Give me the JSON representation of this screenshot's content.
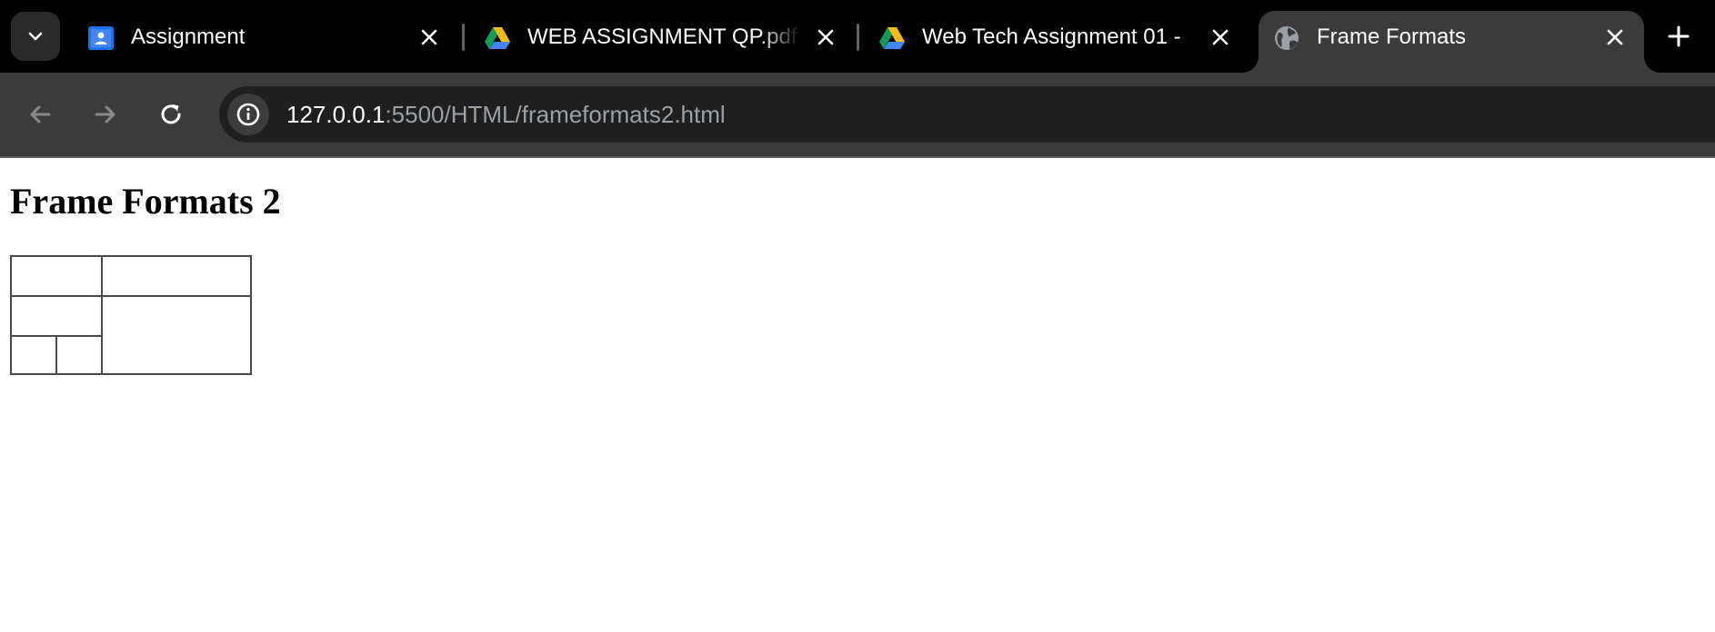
{
  "browser": {
    "tabs": [
      {
        "title": "Assignment",
        "icon": "google-classroom-icon",
        "active": false
      },
      {
        "title": "WEB ASSIGNMENT QP.pdf - ",
        "icon": "google-drive-icon",
        "active": false
      },
      {
        "title": "Web Tech Assignment 01 - ",
        "icon": "google-drive-icon",
        "active": false
      },
      {
        "title": "Frame Formats",
        "icon": "globe-icon",
        "active": true
      }
    ],
    "address_bar": {
      "host": "127.0.0.1",
      "path": ":5500/HTML/frameformats2.html"
    },
    "colors": {
      "tabstrip_bg": "#000000",
      "toolbar_bg": "#3b3b3b",
      "omnibox_bg": "#1f1f1f",
      "url_path": "#9aa0a6"
    }
  },
  "page": {
    "heading": "Frame Formats 2",
    "frames_layout": {
      "description_left_column": [
        "top-left frame",
        "middle-left frame",
        "bottom-left-a frame",
        "bottom-left-b frame"
      ],
      "description_right_column": [
        "top-right frame",
        "bottom-right frame"
      ]
    }
  }
}
